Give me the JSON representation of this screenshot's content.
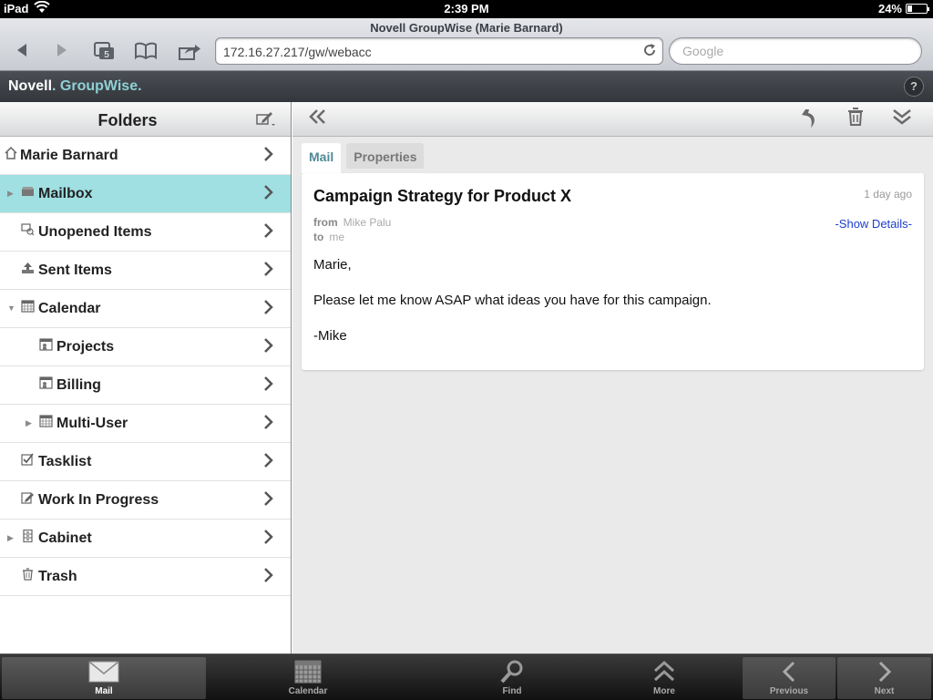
{
  "statusbar": {
    "carrier": "iPad",
    "time": "2:39 PM",
    "battery": "24%",
    "battery_level": 0.24
  },
  "browser": {
    "page_title": "Novell GroupWise (Marie Barnard)",
    "tabs_count": "5",
    "url": "172.16.27.217/gw/webacc",
    "search_placeholder": "Google"
  },
  "app": {
    "brand_novell": "Novell",
    "brand_groupwise": "GroupWise",
    "help_label": "?"
  },
  "sidebar": {
    "title": "Folders",
    "folders": [
      {
        "label": "Marie Barnard",
        "icon": "home-icon"
      },
      {
        "label": "Mailbox",
        "icon": "mailbox-icon",
        "selected": true
      },
      {
        "label": "Unopened Items",
        "icon": "unopened-icon"
      },
      {
        "label": "Sent Items",
        "icon": "sent-icon"
      },
      {
        "label": "Calendar",
        "icon": "calendar-icon"
      },
      {
        "label": "Projects",
        "icon": "shared-folder-icon"
      },
      {
        "label": "Billing",
        "icon": "shared-folder-icon"
      },
      {
        "label": "Multi-User",
        "icon": "calendar-icon"
      },
      {
        "label": "Tasklist",
        "icon": "checklist-icon"
      },
      {
        "label": "Work In Progress",
        "icon": "pencil-icon"
      },
      {
        "label": "Cabinet",
        "icon": "cabinet-icon"
      },
      {
        "label": "Trash",
        "icon": "trash-icon"
      }
    ]
  },
  "content": {
    "tabs": [
      "Mail",
      "Properties"
    ],
    "message": {
      "subject": "Campaign Strategy for Product X",
      "age": "1 day ago",
      "from_label": "from",
      "from": "Mike Palu",
      "to_label": "to",
      "to": "me",
      "show_details": "-Show Details-",
      "body": [
        "Marie,",
        "Please let me know ASAP what ideas you have for this campaign.",
        "-Mike"
      ]
    }
  },
  "tabbar": {
    "items": [
      {
        "label": "Mail",
        "icon": "mail-icon"
      },
      {
        "label": "Calendar",
        "icon": "calendar-icon"
      },
      {
        "label": "Find",
        "icon": "magnifier-icon"
      },
      {
        "label": "More",
        "icon": "double-chevron-up-icon"
      },
      {
        "label": "Previous",
        "icon": "chevron-left-icon"
      },
      {
        "label": "Next",
        "icon": "chevron-right-icon"
      }
    ]
  }
}
